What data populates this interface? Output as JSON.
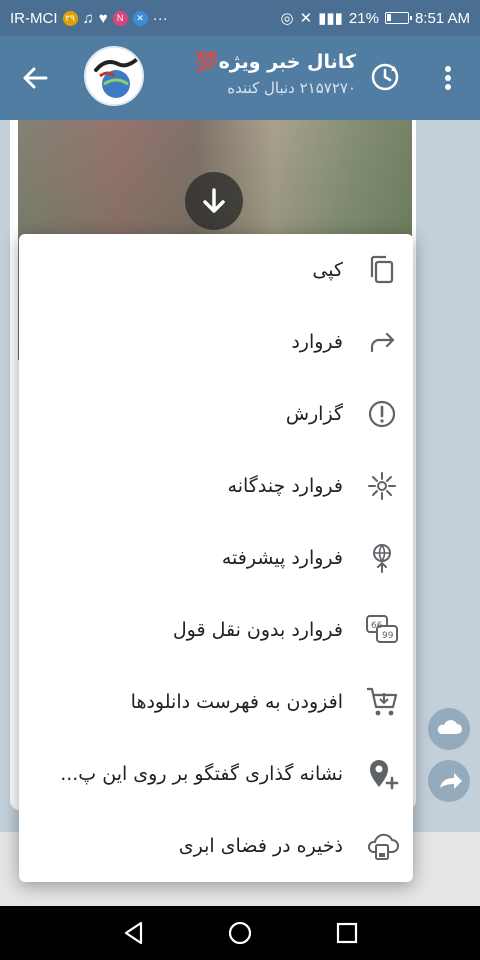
{
  "status_bar": {
    "carrier": "IR-MCI",
    "battery_percent": "21%",
    "time": "8:51 AM",
    "dots": "···"
  },
  "channel": {
    "title": "کانال خبر ویژه💯",
    "subscribers": "۲۱۵۷۲۷۰ دنبال کننده"
  },
  "menu": {
    "items": [
      {
        "label": "کپی",
        "icon": "copy-icon"
      },
      {
        "label": "فروارد",
        "icon": "forward-arrow-icon"
      },
      {
        "label": "گزارش",
        "icon": "report-icon"
      },
      {
        "label": "فروارد چندگانه",
        "icon": "multi-forward-icon"
      },
      {
        "label": "فروارد پیشرفته",
        "icon": "advanced-forward-icon"
      },
      {
        "label": "فروارد بدون نقل قول",
        "icon": "quote-icon"
      },
      {
        "label": "افزودن به فهرست دانلودها",
        "icon": "cart-icon"
      },
      {
        "label": "نشانه گذاری گفتگو بر روی این پ...",
        "icon": "location-add-icon"
      },
      {
        "label": "ذخیره در فضای ابری",
        "icon": "cloud-save-icon"
      }
    ]
  },
  "colors": {
    "header": "#517da2",
    "status_bar": "#4b6f93",
    "icon_gray": "#5f6368"
  }
}
